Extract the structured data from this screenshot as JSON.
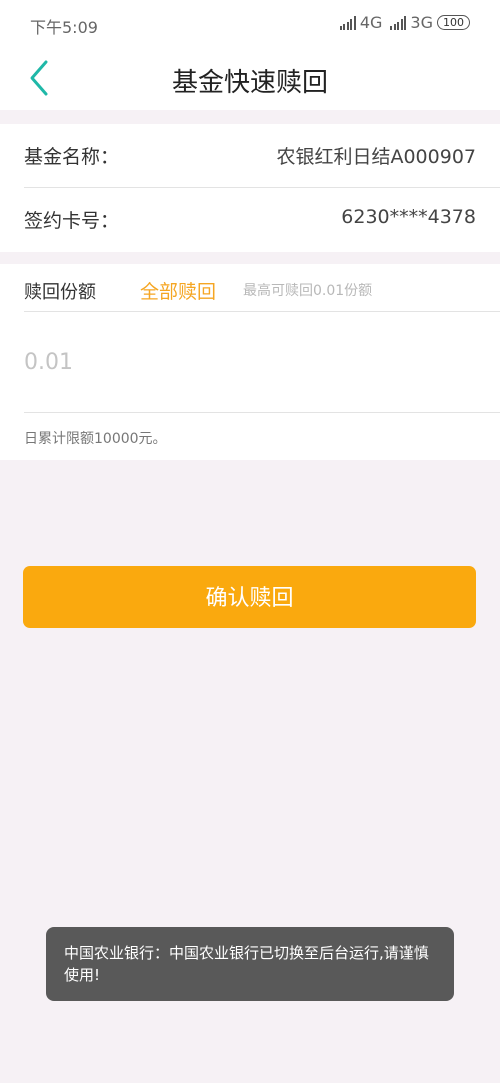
{
  "status_bar": {
    "time": "下午5:09",
    "network_1": "4G",
    "network_1_suffix": "⁴ᴳ",
    "network_2": "3G",
    "battery": "100"
  },
  "header": {
    "title": "基金快速赎回",
    "back_icon": "chevron-left-icon",
    "accent_color": "#1fb8a8"
  },
  "fund_info": {
    "name_label": "基金名称：",
    "name_value": "农银红利日结A000907",
    "card_label": "签约卡号：",
    "card_value": "6230****4378"
  },
  "redeem": {
    "shares_label": "赎回份额",
    "redeem_all_label": "全部赎回",
    "max_hint": "最高可赎回0.01份额",
    "amount_placeholder": "0.01",
    "daily_limit": "日累计限额10000元。"
  },
  "confirm_button": {
    "label": "确认赎回",
    "color": "#faa90e"
  },
  "toast": {
    "message": "中国农业银行：中国农业银行已切换至后台运行,请谨慎使用!"
  }
}
